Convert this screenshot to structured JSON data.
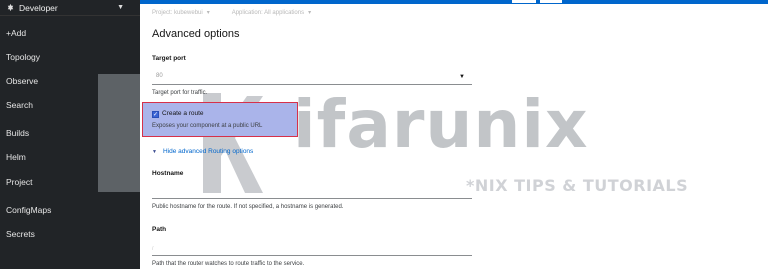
{
  "sidebar": {
    "perspective": "Developer",
    "items": [
      {
        "label": "+Add"
      },
      {
        "label": "Topology"
      },
      {
        "label": "Observe"
      },
      {
        "label": "Search"
      },
      {
        "label": "Builds"
      },
      {
        "label": "Helm"
      },
      {
        "label": "Project"
      },
      {
        "label": "ConfigMaps"
      },
      {
        "label": "Secrets"
      }
    ]
  },
  "context": {
    "project": "Project: kubewebui",
    "application": "Application: All applications"
  },
  "form": {
    "section_title": "Advanced options",
    "target_port": {
      "label": "Target port",
      "value": "80",
      "help": "Target port for traffic."
    },
    "create_route": {
      "checked": true,
      "label": "Create a route",
      "help": "Exposes your component at a public URL"
    },
    "toggle_label": "Hide advanced Routing options",
    "hostname": {
      "label": "Hostname",
      "help": "Public hostname for the route. If not specified, a hostname is generated."
    },
    "path": {
      "label": "Path",
      "value": "/",
      "help": "Path that the router watches to route traffic to the service."
    }
  },
  "watermark": {
    "brand": "ifarunix",
    "tagline": "*NIX TIPS & TUTORIALS"
  },
  "colors": {
    "sidebar_bg": "#212427",
    "accent": "#0066cc",
    "highlight": "#aab4ea",
    "highlight_border": "#d6304a"
  }
}
